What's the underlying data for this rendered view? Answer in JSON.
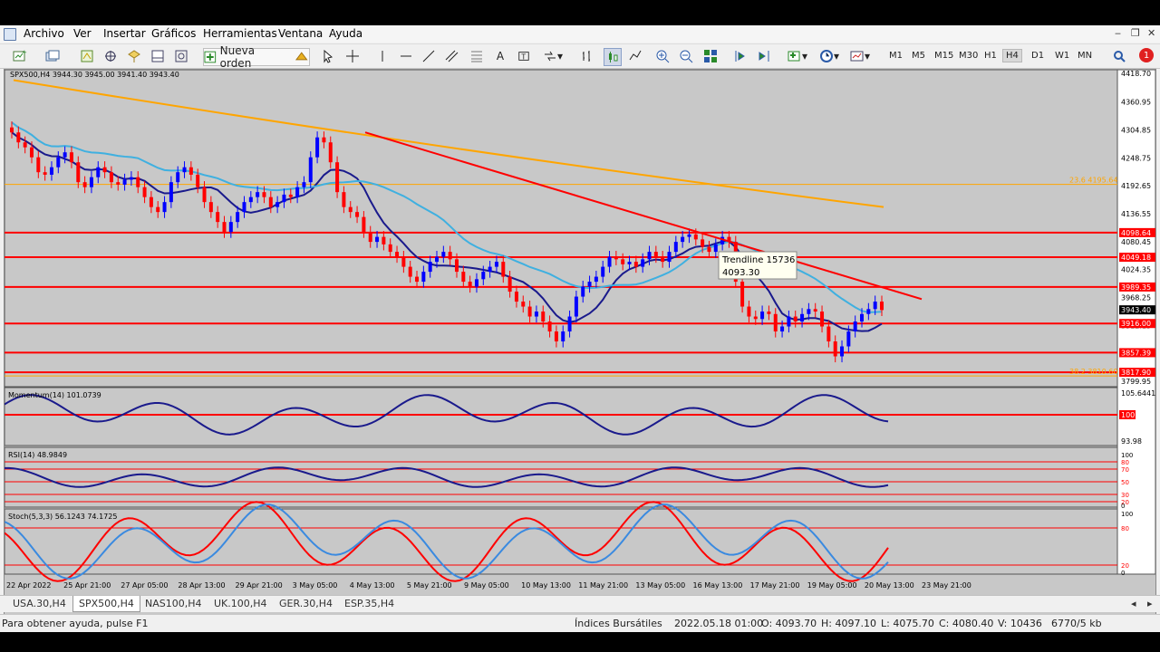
{
  "menu": [
    "Archivo",
    "Ver",
    "Insertar",
    "Gráficos",
    "Herramientas",
    "Ventana",
    "Ayuda"
  ],
  "toolbar": {
    "new_order_label": "Nueva orden"
  },
  "timeframes": [
    "M1",
    "M5",
    "M15",
    "M30",
    "H1",
    "H4",
    "D1",
    "W1",
    "MN"
  ],
  "active_timeframe": "H4",
  "notification_count": "1",
  "chart": {
    "symbol_info": "SPX500,H4  3944.30 3945.00 3941.40 3943.40",
    "price_labels": [
      "4418.70",
      "4360.95",
      "4304.85",
      "4248.75",
      "4192.65",
      "4136.55",
      "4080.45",
      "4024.35",
      "3968.25",
      "3912.15",
      "3799.95"
    ],
    "level_labels": [
      "4098.64",
      "4049.18",
      "3989.35",
      "3943.40",
      "3916.00",
      "3857.39",
      "3817.90"
    ],
    "fib_labels": [
      "23.6 4195.64",
      "38.2 3810.60"
    ],
    "trendline_tooltip": {
      "name": "Trendline 15736",
      "value": "4093.30"
    },
    "momentum_label": "Momentum(14) 101.0739",
    "momentum_scale": [
      "105.6441",
      "100",
      "93.98"
    ],
    "rsi_label": "RSI(14) 48.9849",
    "rsi_scale": [
      "100",
      "80",
      "70",
      "50",
      "30",
      "20",
      "0"
    ],
    "stoch_label": "Stoch(5,3,3) 56.1243 74.1725",
    "stoch_scale": [
      "100",
      "80",
      "20",
      "0"
    ],
    "date_labels": [
      "22 Apr 2022",
      "25 Apr 21:00",
      "27 Apr 05:00",
      "28 Apr 13:00",
      "29 Apr 21:00",
      "3 May 05:00",
      "4 May 13:00",
      "5 May 21:00",
      "9 May 05:00",
      "10 May 13:00",
      "11 May 21:00",
      "13 May 05:00",
      "16 May 13:00",
      "17 May 21:00",
      "19 May 05:00",
      "20 May 13:00",
      "23 May 21:00"
    ]
  },
  "tabs": [
    "USA.30,H4",
    "SPX500,H4",
    "NAS100,H4",
    "UK.100,H4",
    "GER.30,H4",
    "ESP.35,H4"
  ],
  "active_tab": "SPX500,H4",
  "status": {
    "help": "Para obtener ayuda, pulse F1",
    "market": "Índices Bursátiles",
    "datetime": "2022.05.18 01:00",
    "open": "O: 4093.70",
    "high": "H: 4097.10",
    "low": "L: 4075.70",
    "close": "C: 4080.40",
    "volume": "V: 10436",
    "traffic": "6770/5 kb"
  },
  "colors": {
    "candle_up": "#0000ff",
    "candle_down": "#ff0000",
    "ma_fast": "#1a1a8c",
    "ma_mid": "#3fb0e0",
    "ma_slow": "#ffa500",
    "level": "#ff0000",
    "chart_bg": "#c8c8c8"
  }
}
